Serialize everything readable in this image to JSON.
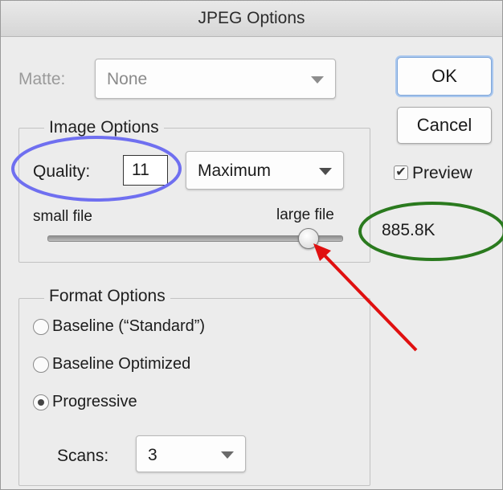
{
  "window": {
    "title": "JPEG Options"
  },
  "matte": {
    "label": "Matte:",
    "value": "None"
  },
  "buttons": {
    "ok": "OK",
    "cancel": "Cancel"
  },
  "image_options": {
    "legend": "Image Options",
    "quality_label": "Quality:",
    "quality_value": "11",
    "quality_preset": "Maximum",
    "small_file": "small file",
    "large_file": "large file",
    "slider_level": 11,
    "slider_max": 12
  },
  "preview": {
    "label": "Preview",
    "checked": true,
    "filesize": "885.8K"
  },
  "format_options": {
    "legend": "Format Options",
    "options": [
      {
        "label": "Baseline (“Standard”)",
        "selected": false
      },
      {
        "label": "Baseline Optimized",
        "selected": false
      },
      {
        "label": "Progressive",
        "selected": true
      }
    ],
    "scans_label": "Scans:",
    "scans_value": "3"
  },
  "annotations": {
    "quality_highlight_color": "#6f6ff0",
    "filesize_highlight_color": "#2a7a1e",
    "arrow_color": "#e01010"
  }
}
